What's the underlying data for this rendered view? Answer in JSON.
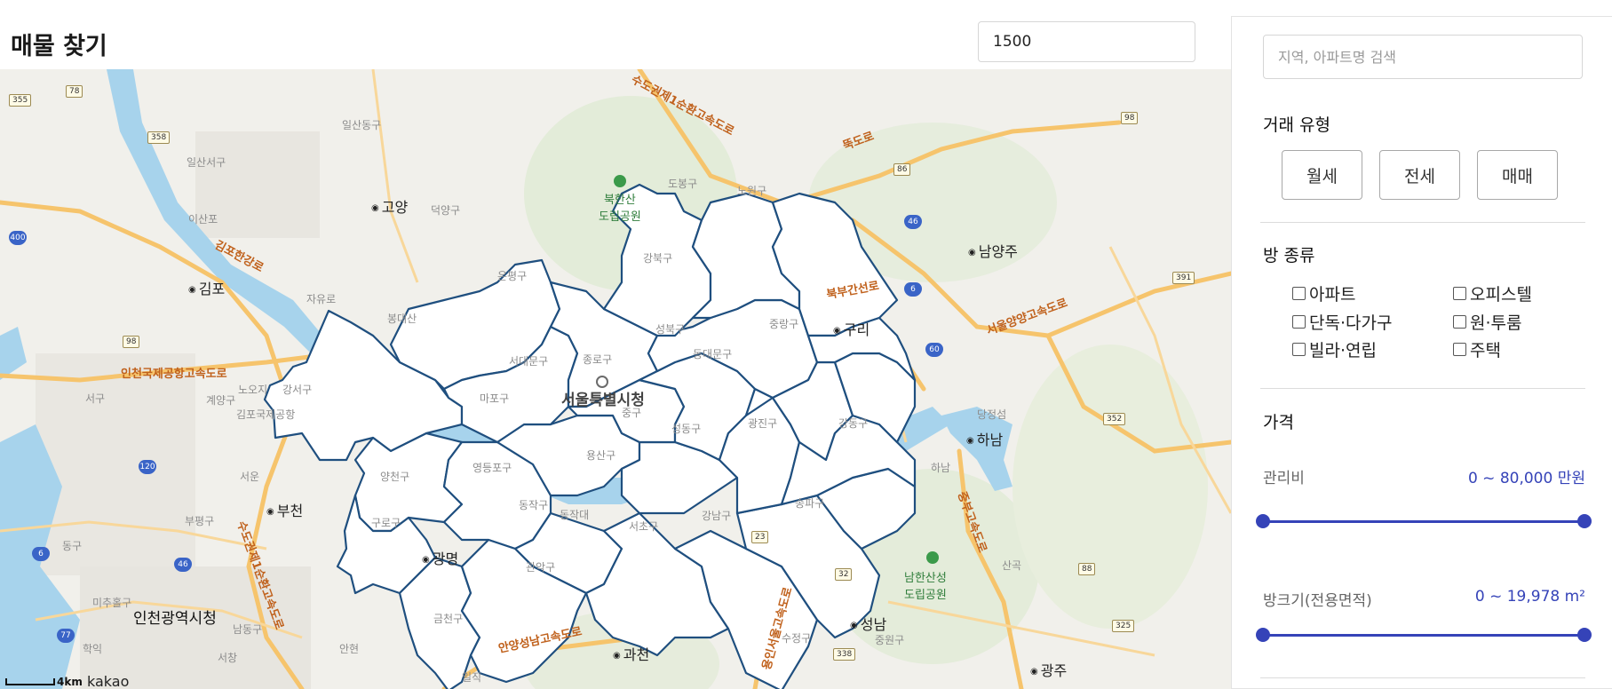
{
  "header": {
    "title": "매물 찾기",
    "input_value": "1500"
  },
  "map": {
    "central_label": "서울특별시청",
    "labels": {
      "ilsan_dong": "일산동구",
      "ilsan_seo": "일산서구",
      "goyang": "고양",
      "deokyang": "덕양구",
      "gimpo": "김포",
      "jayuro": "자유로",
      "ileonpo": "이산포",
      "bongdaesan": "봉대산",
      "seogu": "서구",
      "gyeyang": "계양구",
      "nojoji": "노오지",
      "bucheon": "부천",
      "bupyeong": "부평구",
      "seowoon": "서운",
      "incheon": "인천광역시청",
      "michuhol": "미추홀구",
      "namdong": "남동구",
      "hakik": "학익",
      "seochang": "서창",
      "anhyeon": "안현",
      "iljik": "일직",
      "gwangmyeong": "광명",
      "gwacheon": "과천",
      "seongnam": "성남",
      "sujeong": "수정구",
      "jungwon": "중원구",
      "hanam": "하남",
      "hanam_jc": "하남",
      "guri": "구리",
      "namyangju": "남양주",
      "dangjeong": "당정섬",
      "sangok": "산곡",
      "gwangju": "광주",
      "donggu": "동구",
      "bukhansan": "북한산\n도립공원",
      "namhansanseong": "남한산성\n도립공원",
      "gimpo_airport": "김포국제공항",
      "road_gimpo": "김포한강로",
      "road_incheon_airport": "인천국제공항고속도로",
      "road_seoul_ring": "수도권제1순환고속도로",
      "road_seoul_ring_n": "수도권제1순환고속도로",
      "road_seoul_yangyang": "서울양양고속도로",
      "road_jungbu": "중부고속도로",
      "road_bukbugan": "북부간선로",
      "road_anyang_seongnam": "안양성남고속도로",
      "road_ttukdo": "뚝도로",
      "road_yongin_seoul": "용인서울고속도로",
      "gangseo": "강서구",
      "yangcheon": "양천구",
      "guro": "구로구",
      "geumcheon": "금천구",
      "yeongdeungpo": "영등포구",
      "dongjak": "동작구",
      "gwanak": "관악구",
      "seocho": "서초구",
      "gangnam": "강남구",
      "songpa": "송파구",
      "gangdong": "강동구",
      "mapo": "마포구",
      "seodaemun": "서대문구",
      "eunpyeong": "은평구",
      "jongno": "종로구",
      "jung": "중구",
      "yongsan": "용산구",
      "seongdong": "성동구",
      "gwangjin": "광진구",
      "dongdaemun": "동대문구",
      "jungnang": "중랑구",
      "seongbuk": "성북구",
      "gangbuk": "강북구",
      "dobong": "도봉구",
      "nowon": "노원구",
      "dongjak_dae": "동작대"
    },
    "route_badges": [
      "355",
      "78",
      "358",
      "98",
      "86",
      "98",
      "391",
      "352",
      "88",
      "325",
      "338",
      "32",
      "23",
      "88"
    ],
    "highway_badges": [
      "400",
      "120",
      "6",
      "46",
      "77",
      "46",
      "6",
      "60"
    ],
    "scale_label": "4km",
    "attribution": "kakao"
  },
  "sidebar": {
    "search_placeholder": "지역, 아파트명 검색",
    "deal_type_title": "거래 유형",
    "deal_types": [
      "월세",
      "전세",
      "매매"
    ],
    "room_type_title": "방 종류",
    "room_types": [
      "아파트",
      "오피스텔",
      "단독·다가구",
      "원·투룸",
      "빌라·연립",
      "주택"
    ],
    "price_title": "가격",
    "maintenance_label": "관리비",
    "maintenance_value": "0 ~ 80,000 만원",
    "maintenance_range": [
      0,
      1
    ],
    "area_label": "방크기(전용면적)",
    "area_value": "0 ~ 19,978 m²",
    "area_range": [
      0,
      1
    ]
  },
  "colors": {
    "accent": "#3543b8",
    "district_border": "#1f4f7f",
    "river": "#a7d3ec",
    "road_major": "#f6c46c"
  }
}
